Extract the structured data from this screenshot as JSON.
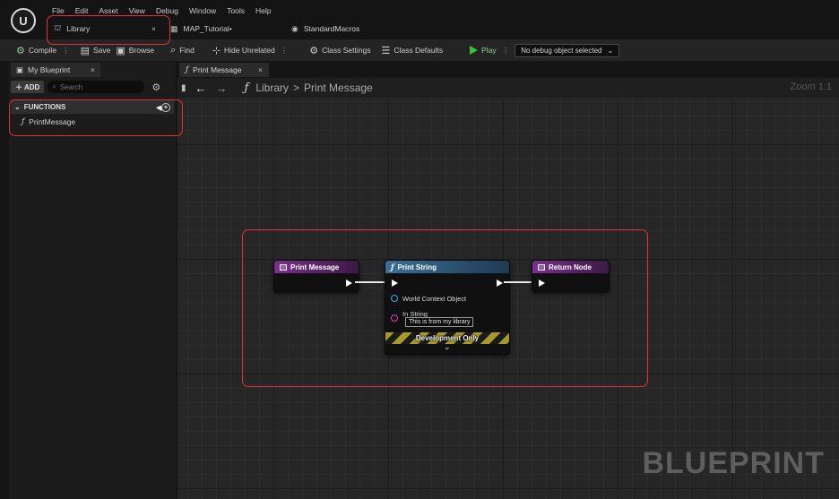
{
  "menu": [
    "File",
    "Edit",
    "Asset",
    "View",
    "Debug",
    "Window",
    "Tools",
    "Help"
  ],
  "doc_tabs": [
    {
      "label": "Library",
      "icon": "blueprint-icon",
      "closable": true
    },
    {
      "label": "MAP_Tutorial•",
      "icon": "map-icon",
      "closable": false
    },
    {
      "label": "StandardMacros",
      "icon": "macro-icon",
      "closable": false
    }
  ],
  "toolbar": {
    "compile": "Compile",
    "save": "Save",
    "browse": "Browse",
    "find": "Find",
    "hide_unrelated": "Hide Unrelated",
    "class_settings": "Class Settings",
    "class_defaults": "Class Defaults",
    "play": "Play",
    "debug_object": "No debug object selected"
  },
  "my_blueprint": {
    "tab_label": "My Blueprint",
    "add_label": "ADD",
    "search_placeholder": "Search",
    "functions_header": "FUNCTIONS",
    "functions": [
      "PrintMessage"
    ]
  },
  "graph": {
    "tab_label": "Print Message",
    "breadcrumb_root": "Library",
    "breadcrumb_sep": ">",
    "breadcrumb_leaf": "Print Message",
    "zoom": "Zoom 1:1",
    "watermark": "BLUEPRINT"
  },
  "nodes": {
    "entry": {
      "title": "Print Message"
    },
    "print_string": {
      "title": "Print String",
      "pin_world_context": "World Context Object",
      "pin_in_string": "In String",
      "in_string_value": "This is from my library",
      "dev_only": "Development Only",
      "expand": "⌄"
    },
    "return": {
      "title": "Return Node"
    }
  },
  "colors": {
    "highlight": "#e0342c",
    "function_header": "#7b2f8f",
    "print_string_header": "#3b6f98",
    "play": "#3fbf3f"
  }
}
